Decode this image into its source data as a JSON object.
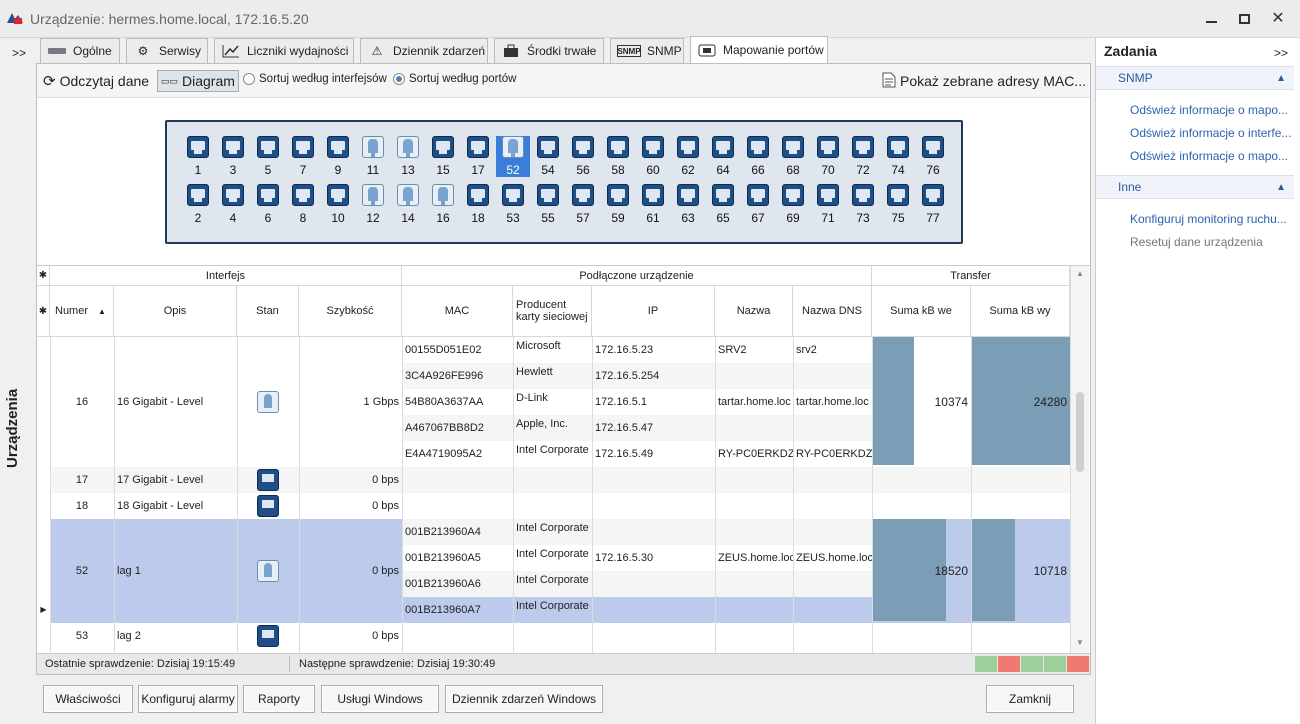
{
  "window": {
    "title": "Urządzenie: hermes.home.local, 172.16.5.20"
  },
  "left_collapse": ">>",
  "left_panel_label": "Urządzenia",
  "tabs": [
    {
      "label": "Ogólne",
      "icon": "device-icon"
    },
    {
      "label": "Serwisy",
      "icon": "gears-icon"
    },
    {
      "label": "Liczniki wydajności",
      "icon": "chart-icon"
    },
    {
      "label": "Dziennik zdarzeń",
      "icon": "warning-icon"
    },
    {
      "label": "Środki trwałe",
      "icon": "assets-icon"
    },
    {
      "label": "SNMP",
      "icon": "snmp-icon"
    },
    {
      "label": "Mapowanie portów",
      "icon": "ports-icon",
      "active": true
    }
  ],
  "toolbar": {
    "refresh": "Odczytaj dane",
    "diagram": "Diagram",
    "sort_interfaces": "Sortuj według interfejsów",
    "sort_ports": "Sortuj według portów",
    "show_mac": "Pokaż zebrane adresy MAC..."
  },
  "ports_top": [
    "1",
    "3",
    "5",
    "7",
    "9",
    "11",
    "13",
    "15",
    "17",
    "52",
    "54",
    "56",
    "58",
    "60",
    "62",
    "64",
    "66",
    "68",
    "70",
    "72",
    "74",
    "76"
  ],
  "ports_bottom": [
    "2",
    "4",
    "6",
    "8",
    "10",
    "12",
    "14",
    "16",
    "18",
    "53",
    "55",
    "57",
    "59",
    "61",
    "63",
    "65",
    "67",
    "69",
    "71",
    "73",
    "75",
    "77"
  ],
  "ports_connected": [
    "11",
    "13",
    "52",
    "12",
    "14",
    "16"
  ],
  "port_selected": "52",
  "grid": {
    "groups": {
      "interface": "Interfejs",
      "device": "Podłączone urządzenie",
      "transfer": "Transfer"
    },
    "columns": {
      "num": "Numer",
      "desc": "Opis",
      "state": "Stan",
      "speed": "Szybkość",
      "mac": "MAC",
      "vendor": "Producent karty sieciowej",
      "ip": "IP",
      "name": "Nazwa",
      "dns": "Nazwa DNS",
      "in": "Suma kB we",
      "out": "Suma kB wy"
    },
    "row16": {
      "num": "16",
      "desc": "16 Gigabit - Level",
      "speed": "1 Gbps",
      "in": "10374",
      "out": "24280",
      "devices": [
        {
          "mac": "00155D051E02",
          "vendor": "Microsoft",
          "ip": "172.16.5.23",
          "name": "SRV2",
          "dns": "srv2"
        },
        {
          "mac": "3C4A926FE996",
          "vendor": "Hewlett",
          "ip": "172.16.5.254",
          "name": "",
          "dns": ""
        },
        {
          "mac": "54B80A3637AA",
          "vendor": "D-Link",
          "ip": "172.16.5.1",
          "name": "tartar.home.loc",
          "dns": "tartar.home.loc"
        },
        {
          "mac": "A467067BB8D2",
          "vendor": "Apple, Inc.",
          "ip": "172.16.5.47",
          "name": "",
          "dns": ""
        },
        {
          "mac": "E4A4719095A2",
          "vendor": "Intel Corporate",
          "ip": "172.16.5.49",
          "name": "RY-PC0ERKDZ",
          "dns": "RY-PC0ERKDZ"
        }
      ]
    },
    "row17": {
      "num": "17",
      "desc": "17 Gigabit - Level",
      "speed": "0 bps"
    },
    "row18": {
      "num": "18",
      "desc": "18 Gigabit - Level",
      "speed": "0 bps"
    },
    "row52": {
      "num": "52",
      "desc": "lag 1",
      "speed": "0 bps",
      "in": "18520",
      "out": "10718",
      "devices": [
        {
          "mac": "001B213960A4",
          "vendor": "Intel Corporate",
          "ip": "",
          "name": "",
          "dns": ""
        },
        {
          "mac": "001B213960A5",
          "vendor": "Intel Corporate",
          "ip": "172.16.5.30",
          "name": "ZEUS.home.loc",
          "dns": "ZEUS.home.loc"
        },
        {
          "mac": "001B213960A6",
          "vendor": "Intel Corporate",
          "ip": "",
          "name": "",
          "dns": ""
        },
        {
          "mac": "001B213960A7",
          "vendor": "Intel Corporate",
          "ip": "",
          "name": "",
          "dns": ""
        }
      ]
    },
    "row53": {
      "num": "53",
      "desc": "lag 2",
      "speed": "0 bps"
    },
    "transfer_fraction": {
      "row16_in": 0.42,
      "row16_out": 1.0,
      "row52_in": 0.75,
      "row52_out": 0.44
    }
  },
  "status": {
    "last": "Ostatnie sprawdzenie: Dzisiaj 19:15:49",
    "next": "Następne sprawdzenie: Dzisiaj 19:30:49"
  },
  "buttons": {
    "props": "Właściwości",
    "alarms": "Konfiguruj alarmy",
    "reports": "Raporty",
    "services": "Usługi Windows",
    "eventlog": "Dziennik zdarzeń Windows",
    "close": "Zamknij"
  },
  "tasks": {
    "title": "Zadania",
    "collapse": ">>",
    "snmp": {
      "label": "SNMP",
      "links": [
        "Odśwież informacje o mapo...",
        "Odśwież informacje o interfe...",
        "Odśwież informacje o mapo..."
      ]
    },
    "other": {
      "label": "Inne",
      "links": [
        "Konfiguruj monitoring ruchu...",
        "Resetuj dane urządzenia"
      ]
    }
  }
}
